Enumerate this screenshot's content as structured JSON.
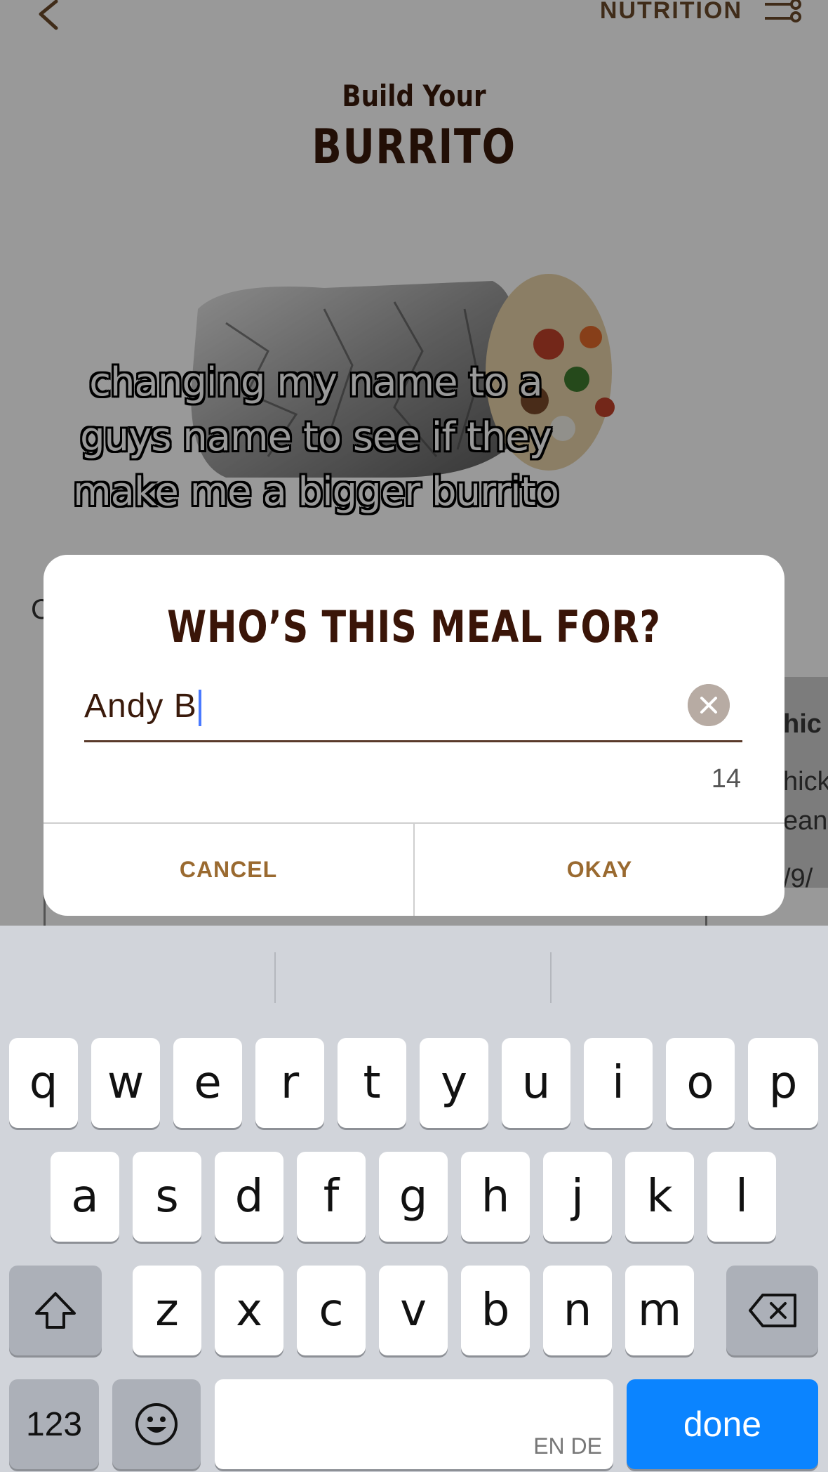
{
  "header": {
    "nutrition_label": "NUTRITION",
    "build_sub": "Build Your",
    "build_title": "BURRITO"
  },
  "caption": {
    "line1": "changing my name to a",
    "line2": "guys name to see if they",
    "line3": "make me a bigger burrito"
  },
  "background_fragments": {
    "left": "C",
    "right": [
      "hic",
      "hick",
      "ean",
      "/9/"
    ]
  },
  "dialog": {
    "title": "WHO’S THIS MEAL FOR?",
    "input_value": "Andy B",
    "counter": "14",
    "cancel_label": "CANCEL",
    "okay_label": "OKAY"
  },
  "keyboard": {
    "row1": [
      "q",
      "w",
      "e",
      "r",
      "t",
      "y",
      "u",
      "i",
      "o",
      "p"
    ],
    "row2": [
      "a",
      "s",
      "d",
      "f",
      "g",
      "h",
      "j",
      "k",
      "l"
    ],
    "row3": [
      "z",
      "x",
      "c",
      "v",
      "b",
      "n",
      "m"
    ],
    "numbers_label": "123",
    "done_label": "done",
    "language_label": "EN DE"
  },
  "colors": {
    "accent_brown": "#3a1508",
    "button_gold": "#9a6a30",
    "done_blue": "#0b84ff"
  }
}
